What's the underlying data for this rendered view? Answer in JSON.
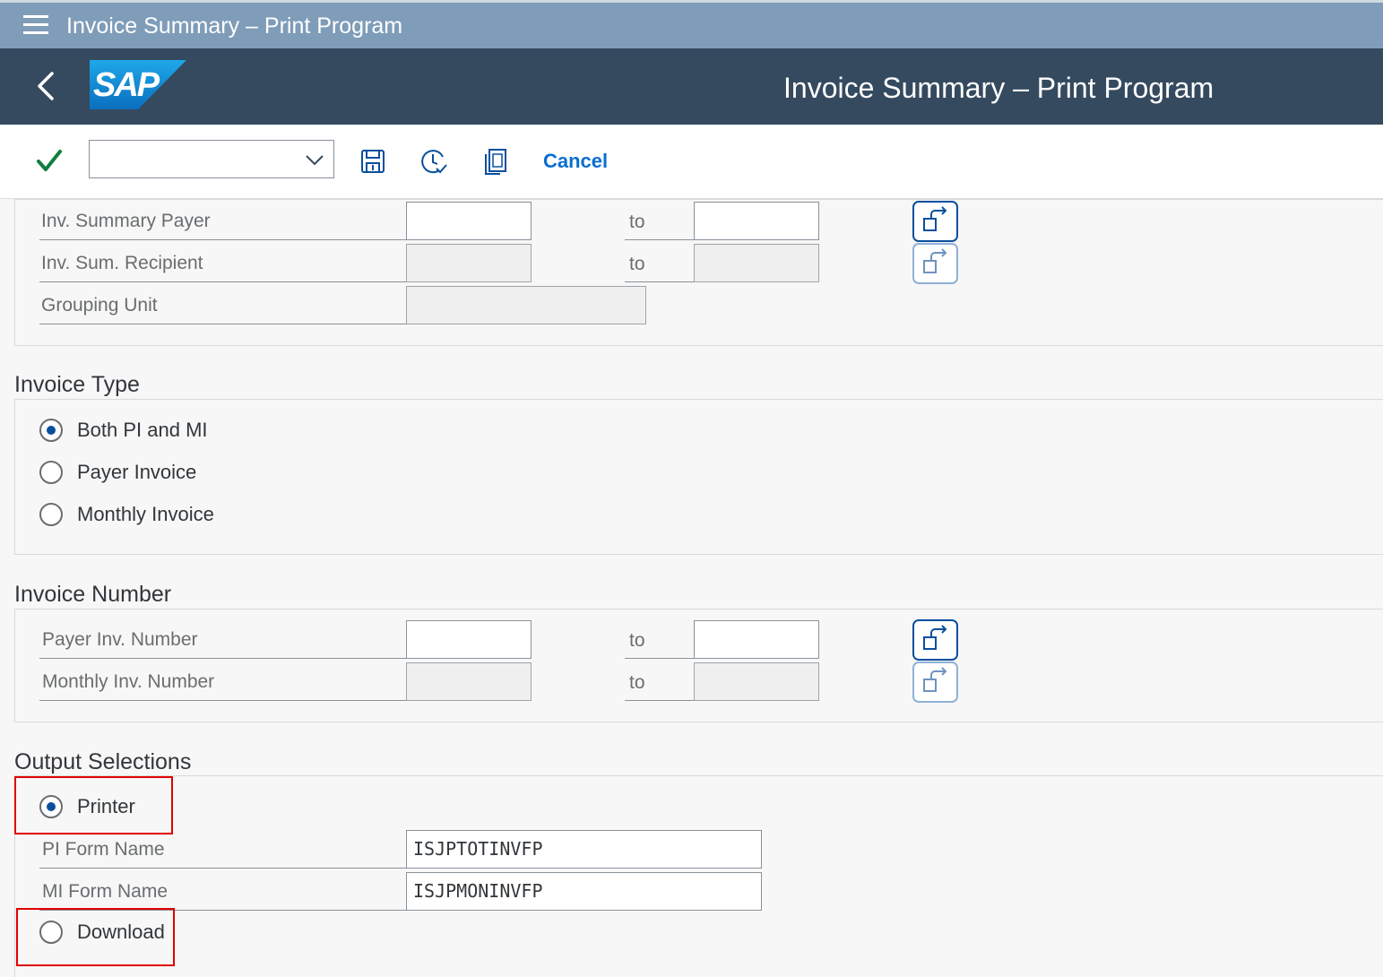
{
  "window": {
    "title": "Invoice Summary – Print Program"
  },
  "shell": {
    "title": "Invoice Summary – Print Program",
    "logo_text": "SAP"
  },
  "toolbar": {
    "variant_value": "",
    "cancel_label": "Cancel"
  },
  "selection": {
    "rows": [
      {
        "label": "Inv. Summary Payer",
        "from": "",
        "to_label": "to",
        "to": "",
        "enabled": true
      },
      {
        "label": "Inv. Sum. Recipient",
        "from": "",
        "to_label": "to",
        "to": "",
        "enabled": false
      },
      {
        "label": "Grouping Unit",
        "value": "",
        "enabled": false
      }
    ]
  },
  "invoice_type": {
    "title": "Invoice Type",
    "options": [
      {
        "label": "Both PI and MI",
        "checked": true
      },
      {
        "label": "Payer Invoice",
        "checked": false
      },
      {
        "label": "Monthly Invoice",
        "checked": false
      }
    ]
  },
  "invoice_number": {
    "title": "Invoice Number",
    "rows": [
      {
        "label": "Payer Inv. Number",
        "from": "",
        "to_label": "to",
        "to": "",
        "enabled": true
      },
      {
        "label": "Monthly Inv. Number",
        "from": "",
        "to_label": "to",
        "to": "",
        "enabled": false
      }
    ]
  },
  "output": {
    "title": "Output Selections",
    "printer_label": "Printer",
    "printer_checked": true,
    "pi_form_label": "PI Form Name",
    "pi_form_value": "ISJPTOTINVFP",
    "mi_form_label": "MI Form Name",
    "mi_form_value": "ISJPMONINVFP",
    "download_label": "Download",
    "download_checked": false
  },
  "colors": {
    "shell": "#354a5f",
    "titlebar": "#7f9cb8",
    "accent": "#0a6ed1",
    "highlight": "#e00000",
    "check": "#107e3e"
  }
}
